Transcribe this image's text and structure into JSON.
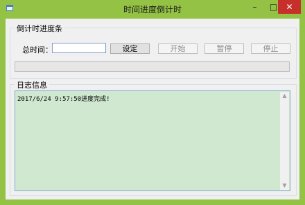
{
  "window": {
    "title": "时间进度倒计时",
    "controls": {
      "minimize": "–",
      "maximize": "□",
      "close": "✕"
    },
    "icon": "app-window-icon"
  },
  "countdown_group": {
    "title": "倒计时进度条",
    "total_time_label": "总时间：",
    "total_time_value": "",
    "set_button": "设定",
    "start_button": "开始",
    "pause_button": "暂停",
    "stop_button": "停止",
    "progress_percent": 0
  },
  "log_group": {
    "title": "日志信息",
    "lines": [
      "2017/6/24 9:57:50进度完成!"
    ]
  },
  "scrollbar": {
    "up": "▲",
    "down": "▼"
  },
  "colors": {
    "frame": "#94c245",
    "close_button": "#c7302a",
    "log_background": "#cfe8cf"
  }
}
